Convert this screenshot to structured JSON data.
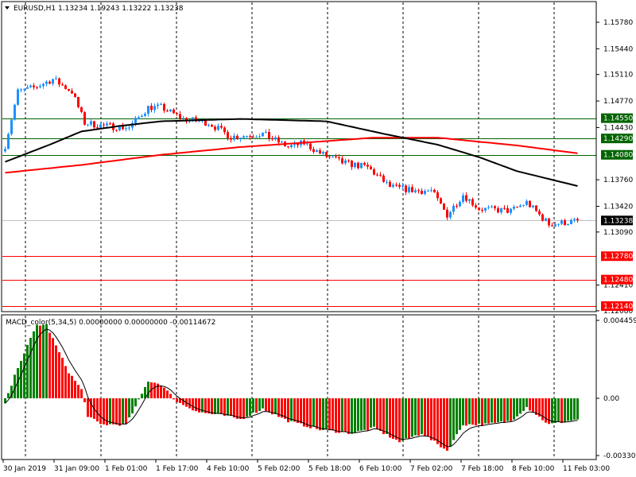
{
  "header": {
    "symbol": "EURUSD,H1",
    "open": "1.13234",
    "high": "1.19243",
    "low": "1.13222",
    "close": "1.13238"
  },
  "macd_header": {
    "name": "MACD_color(5,34,5)",
    "v1": "0.00000000",
    "v2": "0.00000000",
    "v3": "-0.00114672"
  },
  "colors": {
    "bull": "#1e90ff",
    "bear": "#ff0000",
    "ma_fast": "#000000",
    "ma_slow": "#ff0000",
    "support_line": "#ff0000",
    "resistance_line": "#006400",
    "hist_up": "#008000",
    "hist_down": "#ff0000"
  },
  "chart_data": [
    {
      "type": "candlestick",
      "title": "EURUSD,H1",
      "ylim": [
        1.1208,
        1.159
      ],
      "price_ticks": [
        "1.15780",
        "1.15440",
        "1.15110",
        "1.14770",
        "1.14430",
        "1.13760",
        "1.13420",
        "1.13090",
        "1.12410",
        "1.12080"
      ],
      "close_anchors": [
        [
          0,
          1.142
        ],
        [
          4,
          1.1489
        ],
        [
          9,
          1.1494
        ],
        [
          15,
          1.1505
        ],
        [
          21,
          1.1489
        ],
        [
          25,
          1.1449
        ],
        [
          31,
          1.1445
        ],
        [
          39,
          1.1443
        ],
        [
          45,
          1.1469
        ],
        [
          49,
          1.1469
        ],
        [
          56,
          1.1454
        ],
        [
          64,
          1.1449
        ],
        [
          71,
          1.1431
        ],
        [
          81,
          1.1435
        ],
        [
          89,
          1.1418
        ],
        [
          94,
          1.1423
        ],
        [
          99,
          1.141
        ],
        [
          106,
          1.1398
        ],
        [
          114,
          1.1392
        ],
        [
          121,
          1.1367
        ],
        [
          129,
          1.1362
        ],
        [
          134,
          1.1362
        ],
        [
          139,
          1.1331
        ],
        [
          144,
          1.1357
        ],
        [
          149,
          1.1339
        ],
        [
          159,
          1.1336
        ],
        [
          164,
          1.1347
        ],
        [
          171,
          1.1319
        ],
        [
          180,
          1.1323
        ]
      ],
      "ma_fast": [
        [
          0,
          1.1399
        ],
        [
          14,
          1.1421
        ],
        [
          24,
          1.1438
        ],
        [
          36,
          1.1445
        ],
        [
          49,
          1.1451
        ],
        [
          74,
          1.1454
        ],
        [
          101,
          1.1451
        ],
        [
          119,
          1.1435
        ],
        [
          136,
          1.1421
        ],
        [
          149,
          1.1405
        ],
        [
          161,
          1.1387
        ],
        [
          180,
          1.1368
        ]
      ],
      "ma_slow": [
        [
          0,
          1.1385
        ],
        [
          24,
          1.1395
        ],
        [
          49,
          1.1408
        ],
        [
          74,
          1.1418
        ],
        [
          99,
          1.1425
        ],
        [
          116,
          1.143
        ],
        [
          136,
          1.143
        ],
        [
          161,
          1.142
        ],
        [
          180,
          1.141
        ]
      ],
      "levels": [
        {
          "price": "1.14550",
          "kind": "resistance"
        },
        {
          "price": "1.14290",
          "kind": "resistance"
        },
        {
          "price": "1.14080",
          "kind": "resistance"
        },
        {
          "price": "1.13238",
          "kind": "current"
        },
        {
          "price": "1.12780",
          "kind": "support"
        },
        {
          "price": "1.12480",
          "kind": "support"
        },
        {
          "price": "1.12140",
          "kind": "support"
        }
      ],
      "x_labels": [
        "30 Jan 2019",
        "31 Jan 09:00",
        "1 Feb 01:00",
        "1 Feb 17:00",
        "4 Feb 10:00",
        "5 Feb 02:00",
        "5 Feb 18:00",
        "6 Feb 10:00",
        "7 Feb 02:00",
        "7 Feb 18:00",
        "8 Feb 10:00",
        "11 Feb 03:00"
      ],
      "bars": 181
    },
    {
      "type": "bar",
      "title": "MACD_color(5,34,5)",
      "ylim": [
        -0.003304,
        0.0044594
      ],
      "y_ticks": [
        "0.0044594",
        "0.00",
        "-0.003304"
      ],
      "hist_anchors": [
        [
          0,
          -0.0003
        ],
        [
          4,
          0.0018
        ],
        [
          7,
          0.003
        ],
        [
          10,
          0.0042
        ],
        [
          13,
          0.0042
        ],
        [
          16,
          0.003
        ],
        [
          20,
          0.0015
        ],
        [
          24,
          0.0005
        ],
        [
          26,
          -0.001
        ],
        [
          30,
          -0.0015
        ],
        [
          38,
          -0.0015
        ],
        [
          41,
          -0.0005
        ],
        [
          45,
          0.001
        ],
        [
          49,
          0.0008
        ],
        [
          54,
          -0.0002
        ],
        [
          61,
          -0.0008
        ],
        [
          69,
          -0.001
        ],
        [
          74,
          -0.0012
        ],
        [
          81,
          -0.0006
        ],
        [
          89,
          -0.0013
        ],
        [
          99,
          -0.0018
        ],
        [
          109,
          -0.002
        ],
        [
          116,
          -0.0017
        ],
        [
          124,
          -0.0025
        ],
        [
          131,
          -0.002
        ],
        [
          139,
          -0.003
        ],
        [
          144,
          -0.0015
        ],
        [
          151,
          -0.0015
        ],
        [
          159,
          -0.0013
        ],
        [
          164,
          -0.0005
        ],
        [
          171,
          -0.0015
        ],
        [
          180,
          -0.0012
        ]
      ]
    }
  ]
}
